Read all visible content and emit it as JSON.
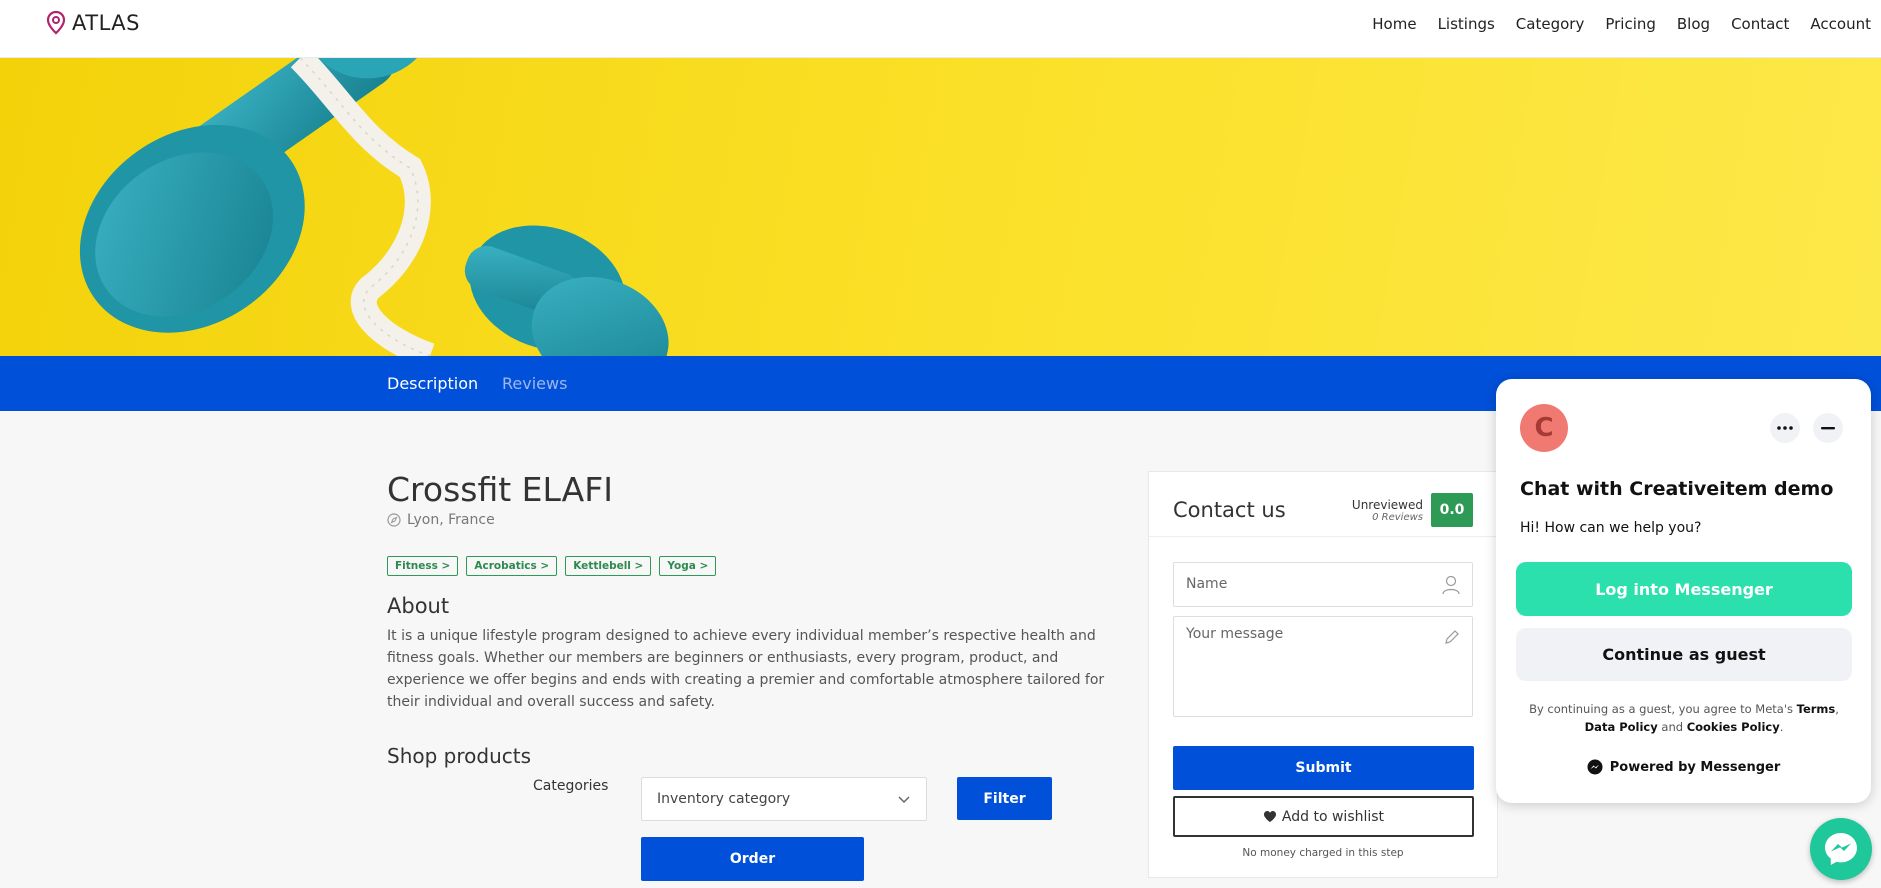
{
  "header": {
    "logo_text": "ATLAS",
    "nav": [
      "Home",
      "Listings",
      "Category",
      "Pricing",
      "Blog",
      "Contact",
      "Account"
    ]
  },
  "tabs": {
    "description": "Description",
    "reviews": "Reviews"
  },
  "listing": {
    "title": "Crossfit ELAFI",
    "location": "Lyon, France",
    "tags": [
      "Fitness >",
      "Acrobatics >",
      "Kettlebell >",
      "Yoga >"
    ],
    "about_heading": "About",
    "about_text": "It is a unique lifestyle program designed to achieve every individual member’s respective health and fitness goals. Whether our members are beginners or enthusiasts, every program, product, and experience we offer begins and ends with creating a premier and comfortable atmosphere tailored for their individual and overall success and safety."
  },
  "shop": {
    "heading": "Shop products",
    "categories_label": "Categories",
    "select_value": "Inventory category",
    "filter_label": "Filter",
    "order_label": "Order"
  },
  "contact": {
    "heading": "Contact us",
    "status": "Unreviewed",
    "reviews_count": "0 Reviews",
    "rating": "0.0",
    "name_placeholder": "Name",
    "message_placeholder": "Your message",
    "submit_label": "Submit",
    "wishlist_label": "Add to wishlist",
    "note": "No money charged in this step"
  },
  "messenger": {
    "avatar_letter": "C",
    "title": "Chat with Creativeitem demo",
    "greeting": "Hi! How can we help you?",
    "login_label": "Log into Messenger",
    "guest_label": "Continue as guest",
    "legal_prefix": "By continuing as a guest, you agree to Meta's",
    "terms": "Terms",
    "data_policy": "Data Policy",
    "and": "and",
    "cookies": "Cookies Policy",
    "powered": "Powered by Messenger"
  },
  "colors": {
    "brand_blue": "#0050d9",
    "tag_green": "#2d9b56",
    "messenger_green": "#2be0ad"
  }
}
